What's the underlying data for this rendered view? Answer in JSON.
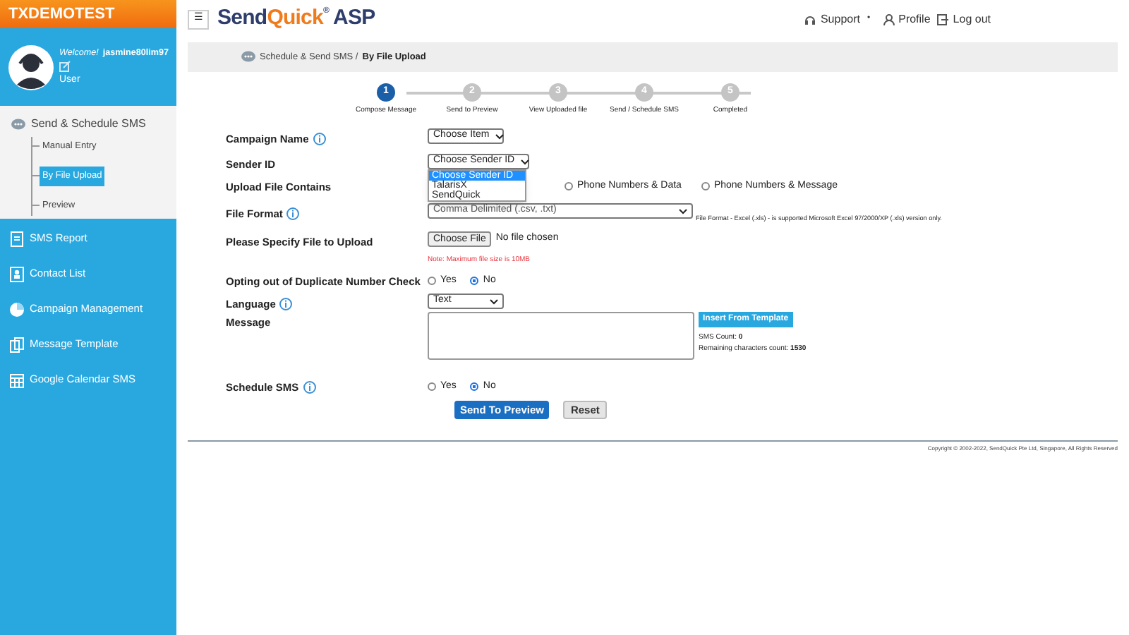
{
  "sidebar": {
    "brand": "TXDEMOTEST",
    "welcome": "Welcome!",
    "username": "jasmine80lim97",
    "role": "User",
    "section": {
      "label": "Send & Schedule SMS",
      "children": [
        {
          "label": "Manual Entry",
          "selected": false
        },
        {
          "label": "By File Upload",
          "selected": true
        },
        {
          "label": "Preview",
          "selected": false
        }
      ]
    },
    "items": [
      {
        "label": "SMS Report"
      },
      {
        "label": "Contact List"
      },
      {
        "label": "Campaign Management"
      },
      {
        "label": "Message Template"
      },
      {
        "label": "Google Calendar SMS"
      }
    ]
  },
  "header": {
    "menu_glyph": "☰",
    "logo_parts": [
      "Send",
      "Quick",
      "®",
      "ASP"
    ],
    "links": [
      {
        "label": "Support"
      },
      {
        "label": "Profile"
      },
      {
        "label": "Log out"
      }
    ],
    "separator": "•"
  },
  "breadcrumb": {
    "parent": "Schedule & Send SMS /",
    "current": "By File Upload"
  },
  "steps": [
    {
      "number": "1",
      "label": "Compose Message",
      "selected": true
    },
    {
      "number": "2",
      "label": "Send to Preview",
      "selected": false
    },
    {
      "number": "3",
      "label": "View Uploaded file",
      "selected": false
    },
    {
      "number": "4",
      "label": "Send / Schedule SMS",
      "selected": false
    },
    {
      "number": "5",
      "label": "Completed",
      "selected": false
    }
  ],
  "form": {
    "campaign": {
      "label": "Campaign Name",
      "value": "Choose Item"
    },
    "sender": {
      "label": "Sender ID",
      "value": "Choose Sender ID",
      "options": [
        {
          "label": "Choose Sender ID",
          "selected": true
        },
        {
          "label": "TalarisX",
          "selected": false
        },
        {
          "label": "SendQuick",
          "selected": false
        }
      ]
    },
    "contains": {
      "label": "Upload File Contains",
      "options": [
        {
          "label": "Phone Numbers & Data",
          "selected": false
        },
        {
          "label": "Phone Numbers & Message",
          "selected": false
        }
      ]
    },
    "format": {
      "label": "File Format",
      "value": "Comma Delimited (.csv, .txt)",
      "hint": "File Format - Excel (.xls) - is supported Microsoft Excel 97/2000/XP (.xls) version only."
    },
    "file": {
      "label": "Please Specify File to Upload",
      "button": "Choose File",
      "status": "No file chosen",
      "note": "Note: Maximum file size is 10MB"
    },
    "duplicate": {
      "label": "Opting out of Duplicate Number Check",
      "options": [
        {
          "label": "Yes",
          "selected": false
        },
        {
          "label": "No",
          "selected": true
        }
      ]
    },
    "language": {
      "label": "Language",
      "value": "Text"
    },
    "message": {
      "label": "Message",
      "template_button": "Insert From Template",
      "sms_count_label": "SMS Count:",
      "sms_count": "0",
      "remaining_label": "Remaining characters count:",
      "remaining": "1530"
    },
    "schedule": {
      "label": "Schedule SMS",
      "options": [
        {
          "label": "Yes",
          "selected": false
        },
        {
          "label": "No",
          "selected": true
        }
      ]
    },
    "buttons": {
      "submit": "Send To Preview",
      "reset": "Reset"
    }
  },
  "footer": "Copyright © 2002-2022, SendQuick Pte Ltd, Singapore, All Rights Reserved"
}
